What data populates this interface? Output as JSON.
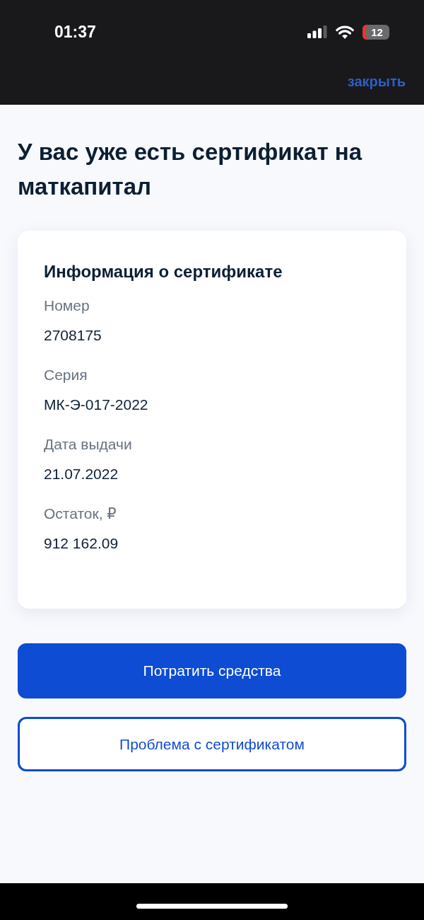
{
  "status_bar": {
    "time": "01:37",
    "battery": "12"
  },
  "header": {
    "close_link": "закрыть"
  },
  "title": "У вас уже есть сертификат на маткапитал",
  "card": {
    "title": "Информация о сертификате",
    "fields": [
      {
        "label": "Номер",
        "value": "2708175"
      },
      {
        "label": "Серия",
        "value": "МК-Э-017-2022"
      },
      {
        "label": "Дата выдачи",
        "value": "21.07.2022"
      },
      {
        "label": "Остаток, ₽",
        "value": "912 162.09"
      }
    ]
  },
  "buttons": [
    {
      "label": "Потратить средства",
      "kind": "primary"
    },
    {
      "label": "Проблема с сертификатом",
      "kind": "secondary"
    }
  ]
}
